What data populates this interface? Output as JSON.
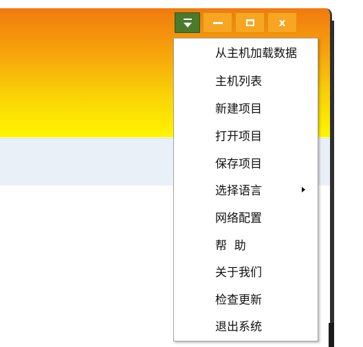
{
  "window_controls": {
    "menu_icon": "menu-triangle-icon",
    "minimize_icon": "minimize-icon",
    "maximize_icon": "maximize-icon",
    "close_label": "x"
  },
  "colors": {
    "title_gradient_top": "#f17a0f",
    "title_gradient_bottom": "#fff500",
    "menu_button": "#4a7a2c",
    "window_buttons": "#f6a623"
  },
  "menu": {
    "items": [
      {
        "label": "从主机加载数据",
        "has_submenu": false
      },
      {
        "label": "主机列表",
        "has_submenu": false
      },
      {
        "label": "新建项目",
        "has_submenu": false
      },
      {
        "label": "打开项目",
        "has_submenu": false
      },
      {
        "label": "保存项目",
        "has_submenu": false
      },
      {
        "label": "选择语言",
        "has_submenu": true
      },
      {
        "label": "网络配置",
        "has_submenu": false
      },
      {
        "label": "帮  助",
        "has_submenu": false
      },
      {
        "label": "关于我们",
        "has_submenu": false
      },
      {
        "label": "检查更新",
        "has_submenu": false
      },
      {
        "label": "退出系统",
        "has_submenu": false
      }
    ]
  }
}
